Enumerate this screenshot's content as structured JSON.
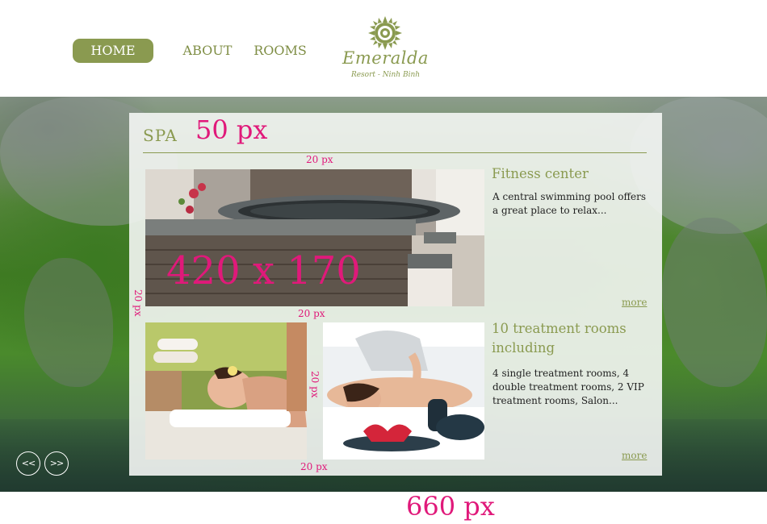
{
  "nav": {
    "items": [
      {
        "label": "HOME",
        "active": true
      },
      {
        "label": "ABOUT",
        "active": false
      },
      {
        "label": "ROOMS",
        "active": false
      }
    ]
  },
  "logo": {
    "name": "Emeralda",
    "tagline": "Resort - Ninh Binh",
    "icon": "sun-lotus-icon"
  },
  "slider": {
    "prev_label": "<<",
    "next_label": ">>"
  },
  "section": {
    "title": "SPA"
  },
  "features": [
    {
      "title": "Fitness center",
      "description": "A central swimming pool offers a great place to relax...",
      "more_label": "more"
    },
    {
      "title": "10 treatment rooms including",
      "description": "4 single treatment rooms, 4 double treatment rooms, 2 VIP treatment rooms, Salon...",
      "more_label": "more"
    }
  ],
  "annotations": {
    "title_height": "50 px",
    "gap_top": "20 px",
    "gap_left": "20 px",
    "gap_middle": "20 px",
    "gap_between_photos": "20 px",
    "gap_bottom": "20 px",
    "image_size": "420 x 170",
    "panel_width": "660 px"
  },
  "colors": {
    "accent": "#8a9a50",
    "annotation": "#e0197a",
    "panel": "#f4f6f4"
  }
}
